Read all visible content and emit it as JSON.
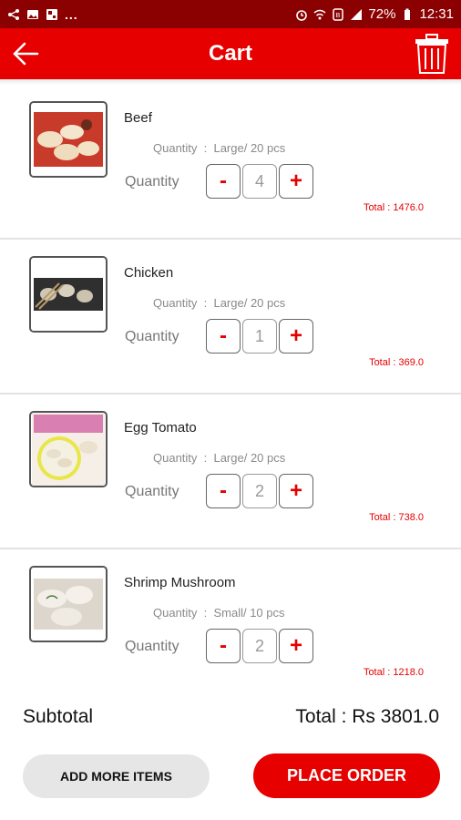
{
  "status_bar": {
    "dots": "...",
    "battery_percent": "72%",
    "time": "12:31",
    "icons": [
      "share-icon",
      "photo-icon",
      "gallery-icon",
      "alarm-icon",
      "wifi-icon",
      "data-saver-icon",
      "signal-icon",
      "battery-icon"
    ]
  },
  "app_bar": {
    "title": "Cart",
    "back_icon": "arrow-left-icon",
    "delete_icon": "trash-icon",
    "color": "#e60000"
  },
  "cart_items": [
    {
      "name": "Beef",
      "size_text": "Quantity  :  Large/ 20 pcs",
      "qty_label": "Quantity",
      "minus": "-",
      "quantity": "4",
      "plus": "+",
      "total": "Total : 1476.0"
    },
    {
      "name": "Chicken",
      "size_text": "Quantity  :  Large/ 20 pcs",
      "qty_label": "Quantity",
      "minus": "-",
      "quantity": "1",
      "plus": "+",
      "total": "Total : 369.0"
    },
    {
      "name": "Egg Tomato",
      "size_text": "Quantity  :  Large/ 20 pcs",
      "qty_label": "Quantity",
      "minus": "-",
      "quantity": "2",
      "plus": "+",
      "total": "Total : 738.0"
    },
    {
      "name": "Shrimp Mushroom",
      "size_text": "Quantity  :  Small/ 10 pcs",
      "qty_label": "Quantity",
      "minus": "-",
      "quantity": "2",
      "plus": "+",
      "total": "Total : 1218.0"
    }
  ],
  "summary": {
    "subtotal_label": "Subtotal",
    "total_text": "Total : Rs 3801.0"
  },
  "actions": {
    "add_more_label": "ADD MORE ITEMS",
    "place_order_label": "PLACE ORDER"
  }
}
